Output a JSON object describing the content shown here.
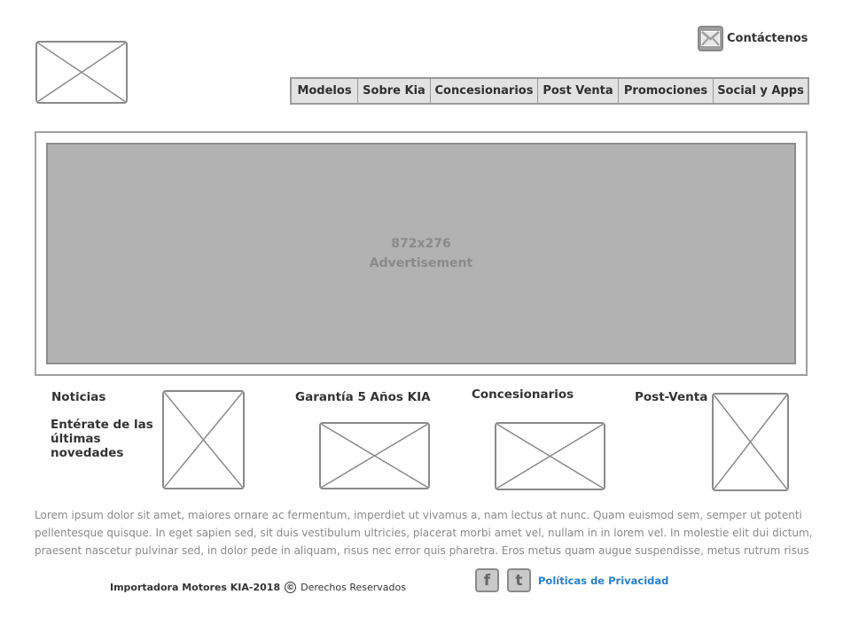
{
  "header": {
    "contact_label": "Contáctenos",
    "contact_icon": "mail-icon",
    "logo_icon": "image-placeholder-icon",
    "nav": [
      "Modelos",
      "Sobre Kia",
      "Concesionarios",
      "Post Venta",
      "Promociones",
      "Social y Apps"
    ]
  },
  "banner": {
    "size_label": "872x276",
    "label": "Advertisement"
  },
  "sections": {
    "news": {
      "title": "Noticias",
      "subtitle": "Entérate de las últimas novedades"
    },
    "warranty": {
      "title": "Garantía 5 Años KIA"
    },
    "dealers": {
      "title": "Concesionarios"
    },
    "postsale": {
      "title": "Post-Venta"
    }
  },
  "body_text": "Lorem ipsum dolor sit amet, maiores ornare ac fermentum, imperdiet ut vivamus a, nam lectus at nunc. Quam euismod sem, semper ut potenti pellentesque quisque. In eget sapien sed, sit duis vestibulum ultricies, placerat morbi amet vel, nullam in in lorem vel. In molestie elit dui dictum, praesent nascetur pulvinar sed, in dolor pede in aliquam, risus nec error quis pharetra. Eros metus quam augue suspendisse, metus rutrum risus",
  "footer": {
    "company": "Importadora Motores KIA-2018",
    "copyright_symbol": "©",
    "rights": "Derechos Reservados",
    "social": [
      {
        "icon": "facebook-icon",
        "glyph": "f"
      },
      {
        "icon": "twitter-icon",
        "glyph": "t"
      }
    ],
    "privacy_link": "Políticas de Privacidad"
  },
  "colors": {
    "placeholder_border": "#8a8a8a",
    "banner_fill": "#b2b2b2",
    "nav_fill": "#e2e2e2",
    "link": "#2a7fc9",
    "body_text": "#8a8a8a"
  }
}
